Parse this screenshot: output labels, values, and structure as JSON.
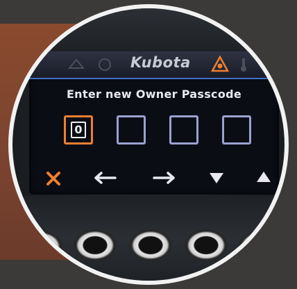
{
  "display": {
    "brand": "Kubota",
    "prompt": "Enter new Owner Passcode",
    "passcode_digits": [
      "0",
      "",
      "",
      ""
    ],
    "active_digit_index": 0
  },
  "status_icons": [
    "mower-icon",
    "hourglass-icon",
    "warning-triangle-icon",
    "temperature-icon",
    "fuel-icon"
  ],
  "softkeys": [
    "cancel-x-icon",
    "arrow-left-icon",
    "arrow-right-icon",
    "triangle-down-icon",
    "triangle-up-icon"
  ],
  "colors": {
    "accent": "#f08030",
    "box_border": "#9aa2d0",
    "underline": "#3e6fc6",
    "screen_bg": "#0a0d14"
  }
}
